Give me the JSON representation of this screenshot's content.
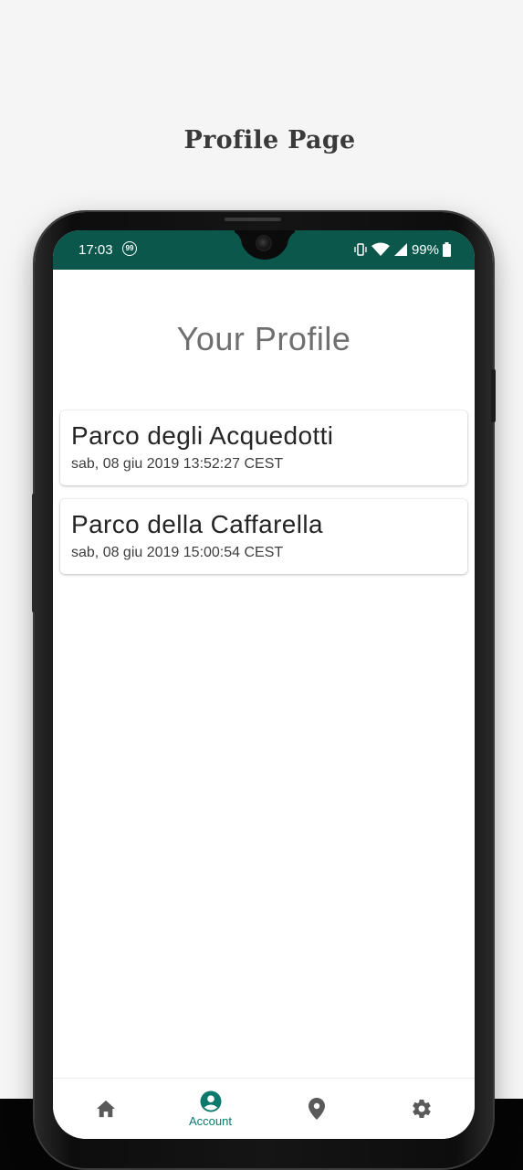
{
  "page": {
    "heading": "Profile Page"
  },
  "status_bar": {
    "time": "17:03",
    "badge": "99",
    "battery": "99%"
  },
  "main": {
    "title": "Your Profile",
    "visits": [
      {
        "name": "Parco degli Acquedotti",
        "date": "sab, 08 giu 2019 13:52:27 CEST"
      },
      {
        "name": "Parco della Caffarella",
        "date": "sab, 08 giu 2019 15:00:54 CEST"
      }
    ]
  },
  "bottom_nav": {
    "items": [
      {
        "icon": "home-icon",
        "label": ""
      },
      {
        "icon": "account-icon",
        "label": "Account",
        "active": true
      },
      {
        "icon": "location-pin-icon",
        "label": ""
      },
      {
        "icon": "gear-icon",
        "label": ""
      }
    ]
  },
  "colors": {
    "status_bar": "#0b574b",
    "accent": "#0b7a6c",
    "inactive_icon": "#5a5a5a"
  }
}
